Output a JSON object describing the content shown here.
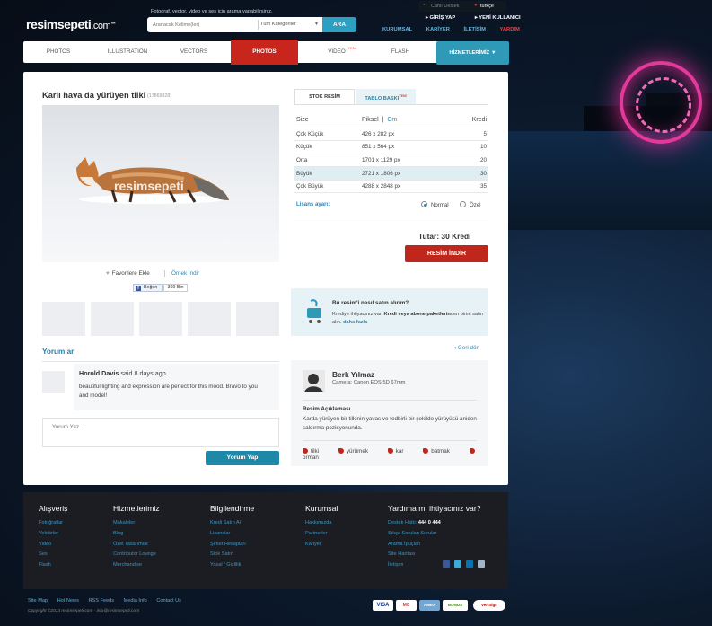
{
  "header": {
    "logo_main": "resimsepeti",
    "logo_tld": ".com",
    "logo_reg": "TM",
    "tagline": "Fotograf, vector, video ve ses icin arama yapabilirsiniz.",
    "search_placeholder": "Aranacak Kelime(ler)",
    "category": "Tüm Kategoriler",
    "search_button": "ARA",
    "live_support": "Canlı Destek",
    "language": "türkçe",
    "login": "GİRİŞ YAP",
    "new_user": "YENİ KULLANICI",
    "links": [
      "KURUMSAL",
      "KARİYER",
      "İLETİŞİM",
      "YARDIM"
    ]
  },
  "nav": {
    "items": [
      "PHOTOS",
      "ILLUSTRATION",
      "VECTORS",
      "PHOTOS",
      "VIDEO",
      "FLASH"
    ],
    "new_badge": "YENİ",
    "services": "HİZMETLERİMİZ"
  },
  "product": {
    "title": "Karlı hava da yürüyen tilki",
    "id": "(17869828)",
    "watermark": "resimsepeti",
    "favorite": "Favorilere Ekle",
    "sample": "Örnek İndir",
    "like": "Beğen",
    "like_count": "369 Bin"
  },
  "comments": {
    "heading": "Yorumlar",
    "author": "Horold Davis",
    "meta": " said 8 days ago.",
    "text": "beautiful lighting and expression are perfect for this mood. Bravo to you and model!",
    "input_placeholder": "Yorum Yaz...",
    "submit": "Yorum Yap"
  },
  "purchase": {
    "tab_stock": "STOK RESİM",
    "tab_print": "TABLO BASKI",
    "tab_new": "YENİ",
    "col_size": "Size",
    "col_pixel": "Piksel",
    "col_cm": "Cm",
    "col_credit": "Kredi",
    "rows": [
      {
        "size": "Çok Küçük",
        "pixel": "426 x 282 px",
        "credit": "5"
      },
      {
        "size": "Küçük",
        "pixel": "851 x 564 px",
        "credit": "10"
      },
      {
        "size": "Orta",
        "pixel": "1701 x 1129 px",
        "credit": "20"
      },
      {
        "size": "Büyük",
        "pixel": "2721 x 1806 px",
        "credit": "30"
      },
      {
        "size": "Çok Büyük",
        "pixel": "4288 x 2848 px",
        "credit": "35"
      }
    ],
    "license_label": "Lisans ayarı:",
    "license_normal": "Normal",
    "license_special": "Özel",
    "total": "Tutar: 30 Kredi",
    "download": "RESİM İNDİR"
  },
  "help": {
    "title": "Bu resim'i nasıl satın alırım?",
    "text_pre": "Krediye ihtiyacınız var, ",
    "text_bold": "Kredi veya abone paketlerin",
    "text_post": "den birini satın alın. ",
    "more": "daha fazla"
  },
  "back": "Geri dön",
  "artist": {
    "name": "Berk Yılmaz",
    "camera": "Camera: Canon EOS 5D 67mm",
    "desc_title": "Resim Açıklaması",
    "desc": "Karda yürüyen bir tilkinin yavas ve tedbirli bir şekilde yürüyüsü aniden saldırma pozisyonunda.",
    "tags": [
      "tilki",
      "yürümek",
      "kar",
      "batmak",
      "orman"
    ]
  },
  "footer": {
    "cols": [
      {
        "title": "Alışveriş",
        "items": [
          "Fotoğraflar",
          "Vektörler",
          "Video",
          "Ses",
          "Flash"
        ]
      },
      {
        "title": "Hizmetlerimiz",
        "items": [
          "Makaleler",
          "Blog",
          "Özel Tasarımlar",
          "Contributor Lounge",
          "Merchandise"
        ]
      },
      {
        "title": "Bilgilendirme",
        "items": [
          "Kredi Satın Al",
          "Lisanslar",
          "Şirket Hesapları",
          "Stok Satın",
          "Yasal / Gizlilik"
        ]
      },
      {
        "title": "Kurumsal",
        "items": [
          "Hakkımızda",
          "Partnerler",
          "Kariyer"
        ]
      }
    ],
    "help_title": "Yardıma mı ihtiyacınız var?",
    "hotline_label": "Destek Hattı:",
    "hotline": "444 0 444",
    "help_items": [
      "Sıkça Sorulan Sorular",
      "Arama İpuçları",
      "Site Haritası",
      "İletişim"
    ],
    "bottom_links": [
      "Site Map",
      "Hot News",
      "RSS Feeds",
      "Media Info",
      "Contact Us"
    ],
    "copyright": "Copyright ©2013 resimsepeti.com - info@resimsepeti.com",
    "payments": [
      "VISA",
      "MC",
      "AMEX",
      "BONUS",
      "VeriSign"
    ]
  },
  "colors": {
    "accent": "#c8261d",
    "teal": "#2e9ab8",
    "link": "#2f86b3"
  }
}
